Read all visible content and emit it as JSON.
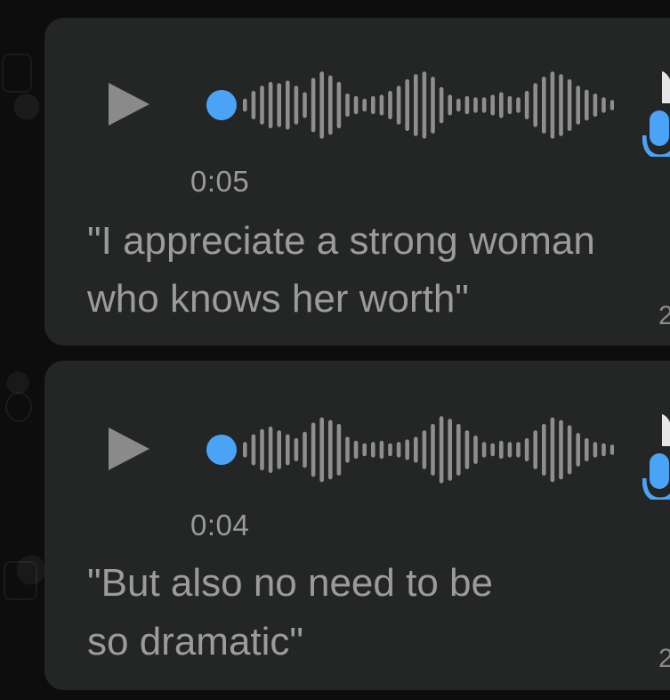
{
  "colors": {
    "bubble": "#242525",
    "accent_blue": "#4aa3f5",
    "waveform_gray": "#8e8e8e",
    "text_gray": "#9b9b9b"
  },
  "messages": [
    {
      "duration": "0:05",
      "transcript_line1": "\"I appreciate a strong woman",
      "transcript_line2": "who knows her worth\"",
      "time_fragment": "2",
      "icons": [
        "play-icon",
        "microphone-icon"
      ]
    },
    {
      "duration": "0:04",
      "transcript_line1": "\"But also no need to be",
      "transcript_line2": "so dramatic\"",
      "time_fragment": "2",
      "icons": [
        "play-icon",
        "microphone-icon"
      ]
    }
  ]
}
